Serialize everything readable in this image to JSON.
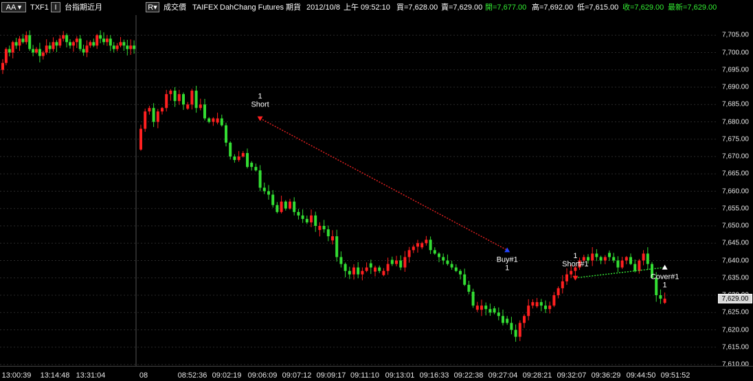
{
  "header": {
    "aa_button": "AA",
    "symbol": "TXF1",
    "interval_button": "I",
    "symbol_name": "台指期近月",
    "r_button": "R",
    "field": "成交價",
    "exchange": "TAIFEX",
    "broker": "DahChang Futures",
    "category": "期貨",
    "date": "2012/10/8",
    "time": "上午 09:52:10",
    "bid": "買=7,628.00",
    "ask": "賣=7,629.00",
    "open": "開=7,677.00",
    "high": "高=7,692.00",
    "low": "低=7,615.00",
    "close": "收=7,629.00",
    "last": "最新=7,629.00"
  },
  "colors": {
    "background": "#000000",
    "up_candle": "#ff2020",
    "down_candle": "#33dd33",
    "green_text": "#33ee33",
    "grid": "#2a2a2a"
  },
  "chart_data": {
    "type": "candlestick",
    "ylim": [
      7610,
      7710
    ],
    "yticks": [
      7610,
      7615,
      7620,
      7625,
      7630,
      7635,
      7640,
      7645,
      7650,
      7655,
      7660,
      7665,
      7670,
      7675,
      7680,
      7685,
      7690,
      7695,
      7700,
      7705
    ],
    "ytick_labels": [
      "7,610.00",
      "7,615.00",
      "7,620.00",
      "7,625.00",
      "7,630.00",
      "7,635.00",
      "7,640.00",
      "7,645.00",
      "7,650.00",
      "7,655.00",
      "7,660.00",
      "7,665.00",
      "7,670.00",
      "7,675.00",
      "7,680.00",
      "7,685.00",
      "7,690.00",
      "7,695.00",
      "7,700.00",
      "7,705.00"
    ],
    "last_price": 7629,
    "last_price_label": "7,629.00",
    "session1_closes": [
      7697,
      7701,
      7700,
      7703,
      7702,
      7704,
      7703,
      7705,
      7701,
      7700,
      7701,
      7699,
      7700,
      7702,
      7701,
      7703,
      7702,
      7704,
      7705,
      7703,
      7702,
      7703,
      7704,
      7701,
      7700,
      7702,
      7703,
      7702,
      7705,
      7704,
      7703,
      7704,
      7702,
      7701,
      7702,
      7703,
      7702,
      7701,
      7702,
      7701
    ],
    "session2_closes": [
      7678,
      7683,
      7684,
      7680,
      7683,
      7684,
      7688,
      7689,
      7686,
      7688,
      7685,
      7685,
      7689,
      7684,
      7685,
      7681,
      7680,
      7681,
      7681,
      7679,
      7674,
      7670,
      7669,
      7670,
      7671,
      7667,
      7667,
      7666,
      7661,
      7660,
      7659,
      7656,
      7654,
      7657,
      7655,
      7657,
      7654,
      7653,
      7652,
      7651,
      7653,
      7650,
      7650,
      7649,
      7647,
      7647,
      7641,
      7639,
      7637,
      7636,
      7638,
      7636,
      7637,
      7638,
      7638,
      7638,
      7637,
      7637,
      7639,
      7639,
      7640,
      7638,
      7641,
      7643,
      7644,
      7645,
      7645,
      7646,
      7643,
      7642,
      7641,
      7640,
      7639,
      7638,
      7637,
      7636,
      7633,
      7631,
      7627,
      7627,
      7627,
      7626,
      7625,
      7625,
      7624,
      7622,
      7622,
      7620,
      7618,
      7622,
      7624,
      7627,
      7628,
      7628,
      7627,
      7626,
      7627,
      7630,
      7632,
      7634,
      7636,
      7637,
      7638,
      7640,
      7641,
      7640,
      7642,
      7641,
      7640,
      7641,
      7641,
      7640,
      7638,
      7640,
      7641,
      7639,
      7637,
      7640,
      7642,
      7639,
      7635,
      7630,
      7629,
      7629
    ],
    "x_tick_labels": [
      "13:00:39",
      "13:14:48",
      "13:31:04",
      "08",
      "08:52:36",
      "09:02:19",
      "09:06:09",
      "09:07:12",
      "09:09:17",
      "09:11:10",
      "09:13:01",
      "09:16:33",
      "09:22:38",
      "09:27:04",
      "09:28:21",
      "09:32:07",
      "09:36:29",
      "09:44:50",
      "09:51:52"
    ],
    "trades": [
      {
        "label": "Short",
        "qty": "1",
        "price": 7681,
        "bar": 28,
        "side": "sell"
      },
      {
        "label": "Buy#1",
        "qty": "1",
        "price": 7643,
        "bar": 86,
        "side": "buy"
      },
      {
        "label": "Short#1",
        "qty": "1",
        "price": 7635,
        "bar": 102,
        "side": "sell"
      },
      {
        "label": "Cover#1",
        "qty": "1",
        "price": 7638,
        "bar": 129,
        "side": "buy"
      }
    ],
    "trade_lines": [
      {
        "from": 0,
        "to": 1,
        "color": "#e02020"
      },
      {
        "from": 2,
        "to": 3,
        "color": "#33dd33"
      }
    ]
  }
}
